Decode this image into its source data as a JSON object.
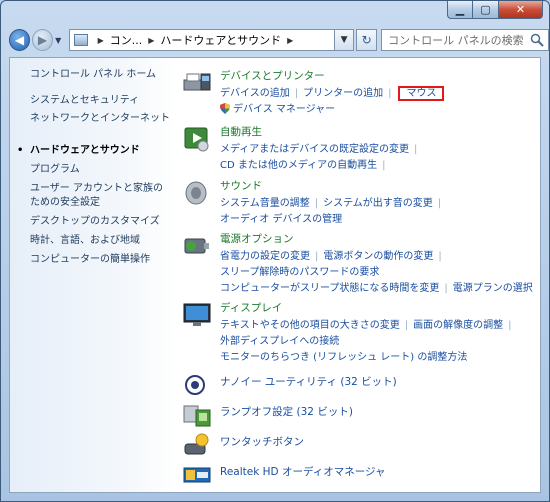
{
  "addressbar": {
    "crumb1": "コン...",
    "crumb2": "ハードウェアとサウンド"
  },
  "search": {
    "placeholder": "コントロール パネルの検索"
  },
  "sidebar": {
    "items": [
      {
        "label": "コントロール パネル ホーム"
      },
      {
        "label": "システムとセキュリティ"
      },
      {
        "label": "ネットワークとインターネット"
      },
      {
        "label": "ハードウェアとサウンド"
      },
      {
        "label": "プログラム"
      },
      {
        "label": "ユーザー アカウントと家族のための安全設定"
      },
      {
        "label": "デスクトップのカスタマイズ"
      },
      {
        "label": "時計、言語、および地域"
      },
      {
        "label": "コンピューターの簡単操作"
      }
    ]
  },
  "categories": {
    "devices": {
      "title": "デバイスとプリンター",
      "links": [
        "デバイスの追加",
        "プリンターの追加",
        "マウス"
      ],
      "manager": "デバイス マネージャー"
    },
    "autoplay": {
      "title": "自動再生",
      "links1": [
        "メディアまたはデバイスの既定設定の変更"
      ],
      "links2": [
        "CD または他のメディアの自動再生"
      ]
    },
    "sound": {
      "title": "サウンド",
      "links1": [
        "システム音量の調整",
        "システムが出す音の変更"
      ],
      "links2": [
        "オーディオ デバイスの管理"
      ]
    },
    "power": {
      "title": "電源オプション",
      "links1": [
        "省電力の設定の変更",
        "電源ボタンの動作の変更"
      ],
      "links2": [
        "スリープ解除時のパスワードの要求"
      ],
      "links3": [
        "コンピューターがスリープ状態になる時間を変更",
        "電源プランの選択"
      ]
    },
    "display": {
      "title": "ディスプレイ",
      "links1": [
        "テキストやその他の項目の大きさの変更",
        "画面の解像度の調整"
      ],
      "links2": [
        "外部ディスプレイへの接続"
      ],
      "links3": [
        "モニターのちらつき (リフレッシュ レート) の調整方法"
      ]
    }
  },
  "apps": [
    {
      "label": "ナノイー ユーティリティ (32 ビット)"
    },
    {
      "label": "ランプオフ設定 (32 ビット)"
    },
    {
      "label": "ワンタッチボタン"
    },
    {
      "label": "Realtek HD オーディオマネージャ"
    }
  ],
  "colors": {
    "category_title": "#1a7a2a",
    "link": "#1a4ea0",
    "highlight": "#e0191d"
  }
}
